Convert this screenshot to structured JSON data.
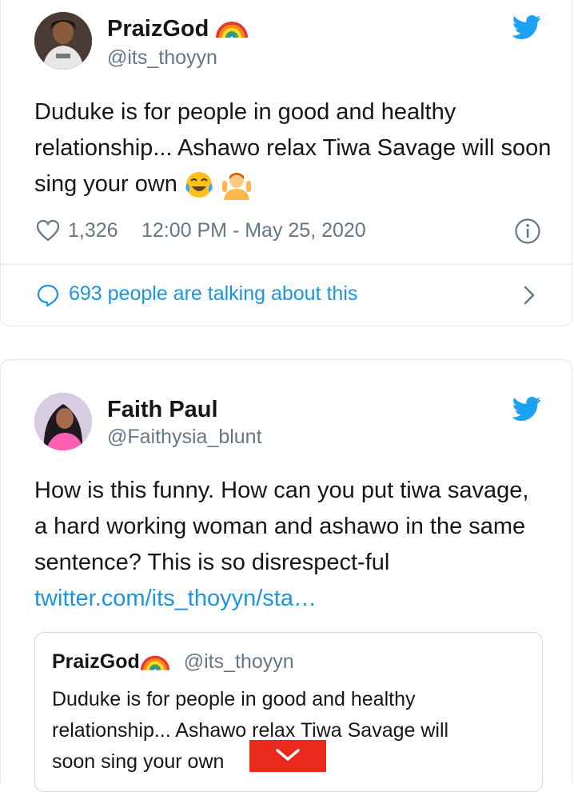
{
  "tweet1": {
    "author_name": "PraizGod",
    "author_handle": "@its_thoyyn",
    "text": "Duduke is for people in good and healthy relationship... Ashawo relax Tiwa Savage will soon sing your own",
    "like_count": "1,326",
    "timestamp": "12:00 PM - May 25, 2020",
    "talking_text": "693 people are talking about this"
  },
  "tweet2": {
    "author_name": "Faith Paul",
    "author_handle": "@Faithysia_blunt",
    "text": "How is this funny. How can you put tiwa savage, a hard working woman and ashawo in the same sentence? This is so disrespect-ful",
    "link_text": "twitter.com/its_thoyyn/sta…",
    "quote": {
      "author_name": "PraizGod",
      "author_handle": "@its_thoyyn",
      "text_line1": "Duduke is for people in good and healthy",
      "text_line2": "relationship... Ashawo relax Tiwa Savage will",
      "text_line3": "soon sing your own"
    }
  },
  "colors": {
    "brand": "#1da1f2",
    "link": "#1b95e0",
    "muted": "#657786",
    "overlay": "#e8291c"
  },
  "icons": [
    "twitter-bird-icon",
    "heart-icon",
    "info-icon",
    "speech-bubble-icon",
    "chevron-right-icon",
    "chevron-down-icon",
    "rainbow-emoji",
    "tears-of-joy-emoji",
    "shrug-emoji"
  ]
}
